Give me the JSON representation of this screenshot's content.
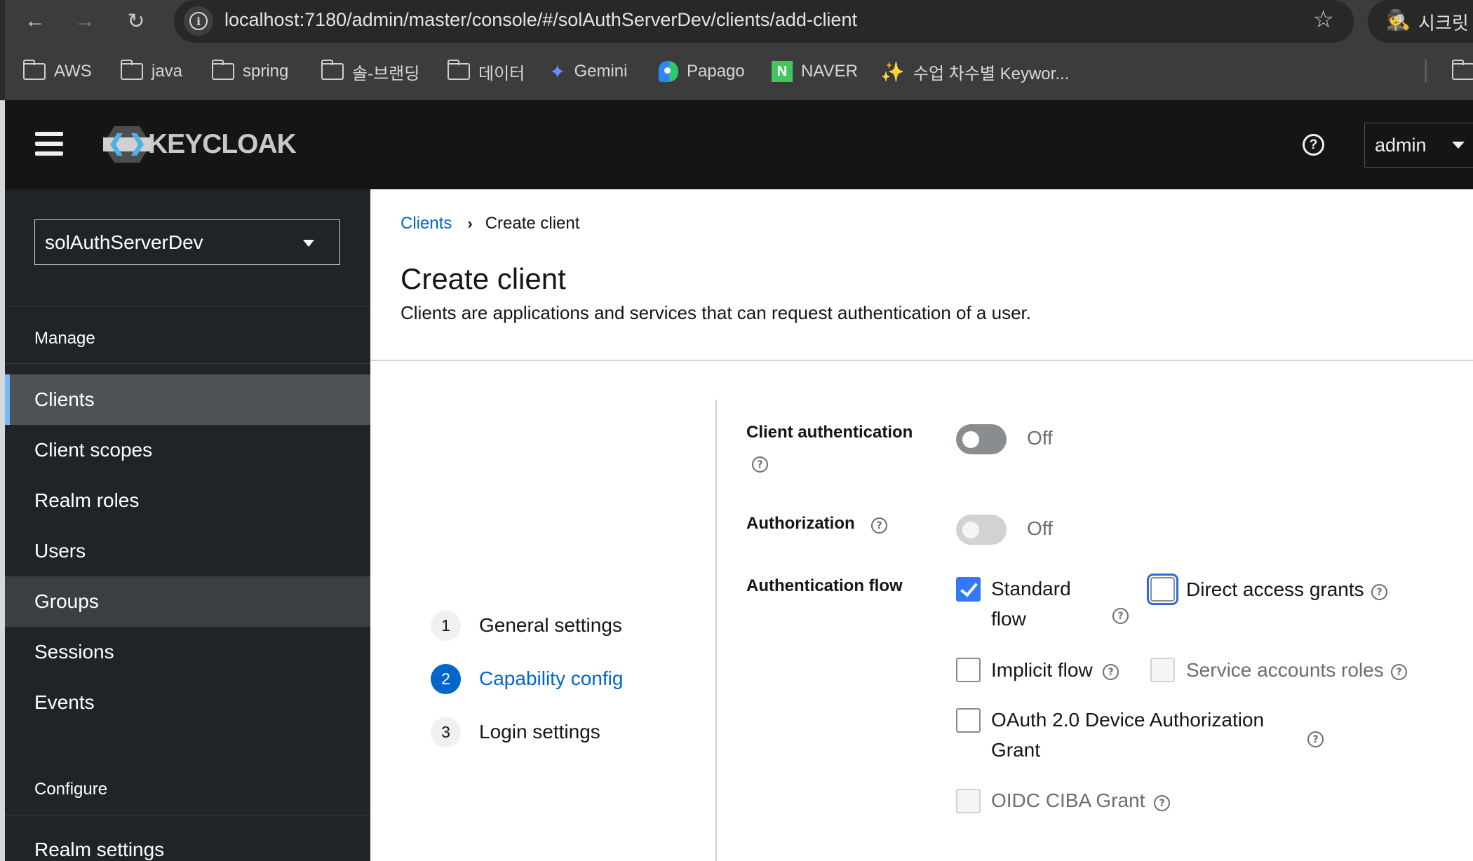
{
  "browser": {
    "url": "localhost:7180/admin/master/console/#/solAuthServerDev/clients/add-client",
    "incognito_label": "시크릿 ...",
    "bookmarks": [
      {
        "label": "AWS",
        "icon": "folder-icon"
      },
      {
        "label": "java",
        "icon": "folder-icon"
      },
      {
        "label": "spring",
        "icon": "folder-icon"
      },
      {
        "label": "솔-브랜딩",
        "icon": "folder-icon"
      },
      {
        "label": "데이터",
        "icon": "folder-icon"
      },
      {
        "label": "Gemini",
        "icon": "gemini-icon"
      },
      {
        "label": "Papago",
        "icon": "papago-icon"
      },
      {
        "label": "NAVER",
        "icon": "naver-icon"
      },
      {
        "label": "수업 차수별 Keywor...",
        "icon": "sparkle-icon"
      }
    ]
  },
  "masthead": {
    "brand": "KEYCLOAK",
    "user": "admin",
    "help_glyph": "?"
  },
  "sidebar": {
    "realm": "solAuthServerDev",
    "groups": [
      {
        "title": "Manage",
        "items": [
          {
            "label": "Clients",
            "state": "current"
          },
          {
            "label": "Client scopes",
            "state": ""
          },
          {
            "label": "Realm roles",
            "state": ""
          },
          {
            "label": "Users",
            "state": ""
          },
          {
            "label": "Groups",
            "state": "hover"
          },
          {
            "label": "Sessions",
            "state": ""
          },
          {
            "label": "Events",
            "state": ""
          }
        ]
      },
      {
        "title": "Configure",
        "items": [
          {
            "label": "Realm settings",
            "state": ""
          }
        ]
      }
    ]
  },
  "main": {
    "breadcrumb": {
      "parent": "Clients",
      "current": "Create client"
    },
    "title": "Create client",
    "description": "Clients are applications and services that can request authentication of a user.",
    "wizard_steps": [
      {
        "number": "1",
        "label": "General settings",
        "active": false
      },
      {
        "number": "2",
        "label": "Capability config",
        "active": true
      },
      {
        "number": "3",
        "label": "Login settings",
        "active": false
      }
    ],
    "form": {
      "client_authentication": {
        "label": "Client authentication",
        "value": "Off",
        "enabled": true
      },
      "authorization": {
        "label": "Authorization",
        "value": "Off",
        "enabled": false
      },
      "authentication_flow": {
        "label": "Authentication flow",
        "options": {
          "standard_flow": {
            "label_line1": "Standard",
            "label_line2": "flow",
            "checked": true,
            "disabled": false
          },
          "direct_access_grants": {
            "label": "Direct access grants",
            "checked": false,
            "disabled": false,
            "focused": true
          },
          "implicit_flow": {
            "label": "Implicit flow",
            "checked": false,
            "disabled": false
          },
          "service_accounts_roles": {
            "label": "Service accounts roles",
            "checked": false,
            "disabled": true
          },
          "oauth_device_grant": {
            "label_line1": "OAuth 2.0 Device Authorization",
            "label_line2": "Grant",
            "checked": false,
            "disabled": false
          },
          "oidc_ciba_grant": {
            "label": "OIDC CIBA Grant",
            "checked": false,
            "disabled": true
          }
        }
      }
    }
  }
}
